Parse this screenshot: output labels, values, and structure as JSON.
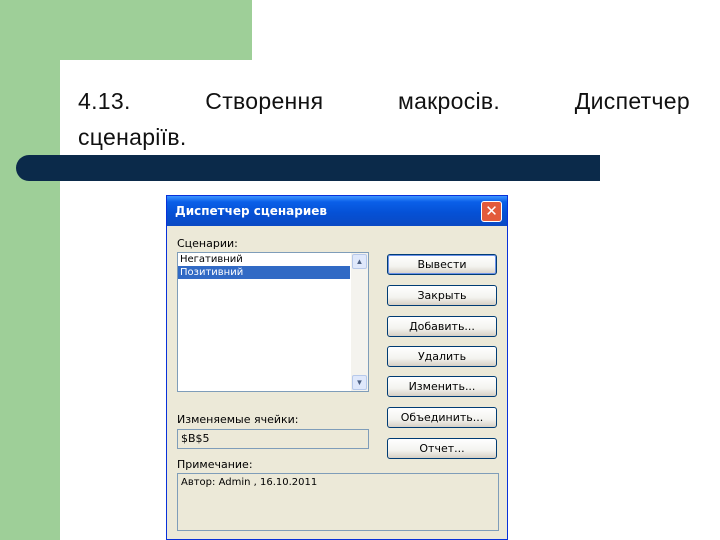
{
  "slide": {
    "title_words_line1": [
      "4.13.",
      "Створення",
      "макросів.",
      "Диспетчер"
    ],
    "title_line2": "сценаріїв."
  },
  "dialog": {
    "title": "Диспетчер сценариев",
    "close_glyph": "✕",
    "scenarios_label": "Сценарии:",
    "scenarios": [
      {
        "label": "Негативний",
        "selected": false
      },
      {
        "label": "Позитивний",
        "selected": true
      }
    ],
    "changing_cells_label": "Изменяемые ячейки:",
    "changing_cells_value": "$B$5",
    "note_label": "Примечание:",
    "note_value": "Автор: Admin , 16.10.2011",
    "buttons": {
      "show": "Вывести",
      "close": "Закрыть",
      "add": "Добавить...",
      "delete": "Удалить",
      "edit": "Изменить...",
      "merge": "Объединить...",
      "summary": "Отчет..."
    }
  },
  "colors": {
    "accent_green": "#9ecf98",
    "title_bar_blue": "#0551d6",
    "dark_bar": "#0b2a4a",
    "selection": "#316ac5"
  }
}
